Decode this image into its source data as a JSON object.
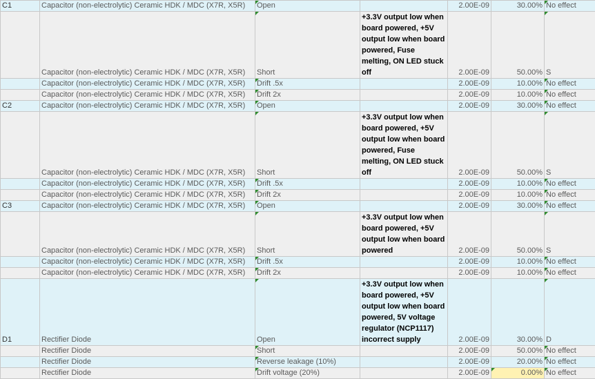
{
  "rows": [
    {
      "ref": "C1",
      "component": "Capacitor (non-electrolytic) Ceramic HDK / MDC (X7R, X5R)",
      "mode": "Open",
      "effect": "",
      "rate": "2.00E-09",
      "pct": "30.00%",
      "sev": "No effect",
      "style": "blue",
      "h": 16,
      "tri_mode": true,
      "tri_sev": true,
      "yel": false
    },
    {
      "ref": "",
      "component": "Capacitor (non-electrolytic) Ceramic HDK / MDC (X7R, X5R)",
      "mode": "Short",
      "effect": "+3.3V output low when board powered, +5V output low when board powered, Fuse melting, ON LED stuck off",
      "rate": "2.00E-09",
      "pct": "50.00%",
      "sev": "S",
      "style": "gray",
      "h": 80,
      "tri_mode": true,
      "tri_sev": true,
      "yel": false
    },
    {
      "ref": "",
      "component": "Capacitor (non-electrolytic) Ceramic HDK / MDC (X7R, X5R)",
      "mode": "Drift .5x",
      "effect": "",
      "rate": "2.00E-09",
      "pct": "10.00%",
      "sev": "No effect",
      "style": "blue",
      "h": 16,
      "tri_mode": true,
      "tri_sev": true,
      "yel": false
    },
    {
      "ref": "",
      "component": "Capacitor (non-electrolytic) Ceramic HDK / MDC (X7R, X5R)",
      "mode": "Drift 2x",
      "effect": "",
      "rate": "2.00E-09",
      "pct": "10.00%",
      "sev": "No effect",
      "style": "gray",
      "h": 16,
      "tri_mode": true,
      "tri_sev": true,
      "yel": false
    },
    {
      "ref": "C2",
      "component": "Capacitor (non-electrolytic) Ceramic HDK / MDC (X7R, X5R)",
      "mode": "Open",
      "effect": "",
      "rate": "2.00E-09",
      "pct": "30.00%",
      "sev": "No effect",
      "style": "blue",
      "h": 16,
      "tri_mode": true,
      "tri_sev": true,
      "yel": false
    },
    {
      "ref": "",
      "component": "Capacitor (non-electrolytic) Ceramic HDK / MDC (X7R, X5R)",
      "mode": "Short",
      "effect": "+3.3V output low when board powered, +5V output low when board powered, Fuse melting, ON LED stuck off",
      "rate": "2.00E-09",
      "pct": "50.00%",
      "sev": "S",
      "style": "gray",
      "h": 80,
      "tri_mode": true,
      "tri_sev": true,
      "yel": false
    },
    {
      "ref": "",
      "component": "Capacitor (non-electrolytic) Ceramic HDK / MDC (X7R, X5R)",
      "mode": "Drift .5x",
      "effect": "",
      "rate": "2.00E-09",
      "pct": "10.00%",
      "sev": "No effect",
      "style": "blue",
      "h": 16,
      "tri_mode": true,
      "tri_sev": true,
      "yel": false
    },
    {
      "ref": "",
      "component": "Capacitor (non-electrolytic) Ceramic HDK / MDC (X7R, X5R)",
      "mode": "Drift 2x",
      "effect": "",
      "rate": "2.00E-09",
      "pct": "10.00%",
      "sev": "No effect",
      "style": "gray",
      "h": 16,
      "tri_mode": true,
      "tri_sev": true,
      "yel": false
    },
    {
      "ref": "C3",
      "component": "Capacitor (non-electrolytic) Ceramic HDK / MDC (X7R, X5R)",
      "mode": "Open",
      "effect": "",
      "rate": "2.00E-09",
      "pct": "30.00%",
      "sev": "No effect",
      "style": "blue",
      "h": 16,
      "tri_mode": true,
      "tri_sev": true,
      "yel": false
    },
    {
      "ref": "",
      "component": "Capacitor (non-electrolytic) Ceramic HDK / MDC (X7R, X5R)",
      "mode": "Short",
      "effect": "+3.3V output low when board powered, +5V output low when board powered",
      "rate": "2.00E-09",
      "pct": "50.00%",
      "sev": "S",
      "style": "gray",
      "h": 64,
      "tri_mode": true,
      "tri_sev": true,
      "yel": false
    },
    {
      "ref": "",
      "component": "Capacitor (non-electrolytic) Ceramic HDK / MDC (X7R, X5R)",
      "mode": "Drift .5x",
      "effect": "",
      "rate": "2.00E-09",
      "pct": "10.00%",
      "sev": "No effect",
      "style": "blue",
      "h": 16,
      "tri_mode": true,
      "tri_sev": true,
      "yel": false
    },
    {
      "ref": "",
      "component": "Capacitor (non-electrolytic) Ceramic HDK / MDC (X7R, X5R)",
      "mode": "Drift 2x",
      "effect": "",
      "rate": "2.00E-09",
      "pct": "10.00%",
      "sev": "No effect",
      "style": "gray",
      "h": 16,
      "tri_mode": true,
      "tri_sev": true,
      "yel": false
    },
    {
      "ref": "D1",
      "component": "Rectifier Diode",
      "mode": "Open",
      "effect": "+3.3V output low when board powered, +5V output low when board powered, 5V voltage regulator (NCP1117) incorrect supply",
      "rate": "2.00E-09",
      "pct": "30.00%",
      "sev": "D",
      "style": "blue",
      "h": 96,
      "tri_mode": true,
      "tri_sev": true,
      "yel": false
    },
    {
      "ref": "",
      "component": "Rectifier Diode",
      "mode": "Short",
      "effect": "",
      "rate": "2.00E-09",
      "pct": "50.00%",
      "sev": "No effect",
      "style": "gray",
      "h": 16,
      "tri_mode": true,
      "tri_sev": true,
      "yel": false
    },
    {
      "ref": "",
      "component": "Rectifier Diode",
      "mode": "Reverse leakage (10%)",
      "effect": "",
      "rate": "2.00E-09",
      "pct": "20.00%",
      "sev": "No effect",
      "style": "blue",
      "h": 16,
      "tri_mode": true,
      "tri_sev": true,
      "yel": false
    },
    {
      "ref": "",
      "component": "Rectifier Diode",
      "mode": "Drift voltage (20%)",
      "effect": "",
      "rate": "2.00E-09",
      "pct": "0.00%",
      "sev": "No effect",
      "style": "gray",
      "h": 16,
      "tri_mode": true,
      "tri_sev": true,
      "yel": true
    }
  ]
}
